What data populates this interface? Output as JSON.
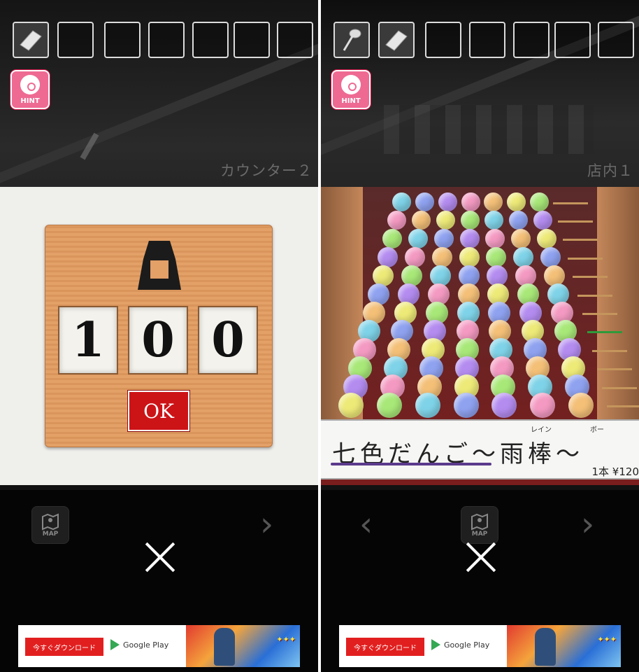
{
  "left": {
    "location_label": "カウンター２",
    "hint_label": "HINT",
    "map_label": "MAP",
    "inventory": [
      "paper",
      "",
      "",
      "",
      "",
      "",
      ""
    ],
    "lock": {
      "digits": [
        "1",
        "0",
        "0"
      ],
      "ok_label": "OK"
    }
  },
  "right": {
    "location_label": "店内１",
    "hint_label": "HINT",
    "map_label": "MAP",
    "inventory": [
      "ladle",
      "paper",
      "",
      "",
      "",
      "",
      ""
    ],
    "sign": {
      "title": "七色だんご～雨棒～",
      "ruby_rain": "レイン",
      "ruby_bo": "ボー",
      "price": "1本 ¥120"
    }
  },
  "ad": {
    "download_label": "今すぐダウンロード",
    "store_label": "Google Play"
  },
  "colors": {
    "hint_pink": "#ee6a93",
    "ok_red": "#cc1417",
    "board_wood": "#e3a067",
    "dango": [
      "#7fd3e8",
      "#8fa2f0",
      "#b48cf0",
      "#f49ac2",
      "#f4c078",
      "#eeea78",
      "#a8e878"
    ]
  }
}
